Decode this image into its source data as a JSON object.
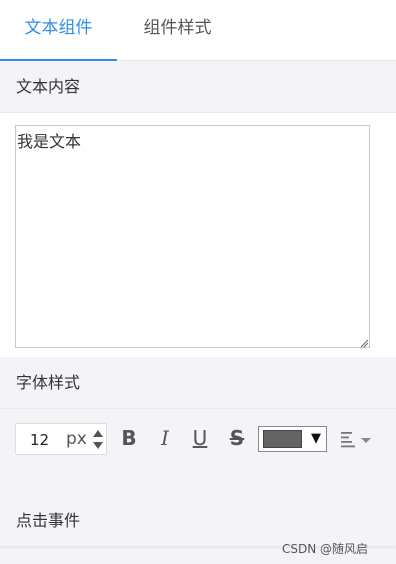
{
  "tabs": [
    {
      "label": "文本组件",
      "active": true
    },
    {
      "label": "组件样式",
      "active": false
    }
  ],
  "accent_color": "#2f8ee8",
  "sections": {
    "content": {
      "title": "文本内容"
    },
    "font": {
      "title": "字体样式"
    },
    "event": {
      "title": "点击事件"
    }
  },
  "text_content": {
    "value": "我是文本"
  },
  "font_style": {
    "size_value": "12",
    "size_unit": "px",
    "buttons": {
      "bold": "B",
      "italic": "I",
      "underline": "U",
      "strike": "S"
    },
    "color": "#646464",
    "color_arrow": "▼",
    "align_icon": "align-left-icon"
  },
  "watermark": "CSDN @随风启"
}
